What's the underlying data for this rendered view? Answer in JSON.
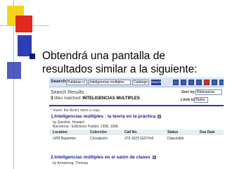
{
  "slide": {
    "bullet_text": "Obtendrá una pantalla de resultados similar a la siguiente:"
  },
  "screenshot": {
    "search": {
      "label": "Search:",
      "field_value": "Palabras cl",
      "query_value": "inteligencias multiples",
      "scope_value": "Catálogo",
      "button_label": "Search"
    },
    "results_title": "Search Results",
    "matched_count": "3",
    "matched_prefix": "titles matched:",
    "matched_query": "INTELIGENCIAS MULTIPLES",
    "sort_by_label": "Sort by:",
    "sort_by_value": "Relevancia",
    "limit_label": "Limit to:",
    "limit_value": "Todos",
    "note": "* mean: the library owns a copy",
    "columns": {
      "location": "Location",
      "collection": "Colección",
      "call_no": "Call No.",
      "status": "Status",
      "due_date": "Due Date"
    },
    "records": [
      {
        "title": "1.Inteligencias múltiples : la teoría en la práctica",
        "author": "by Gardner, Howard",
        "publisher": "Barcelona : Ediciones Paidós, 1998, 1995.",
        "location": "UPR Bayamón",
        "collection": "Circulación",
        "call_no": "370.1523 G227m5",
        "status": "Disponible"
      },
      {
        "title": "2.Inteligencias múltiples en el salón de clases",
        "author": "by Armstrong, Thomas"
      }
    ]
  }
}
